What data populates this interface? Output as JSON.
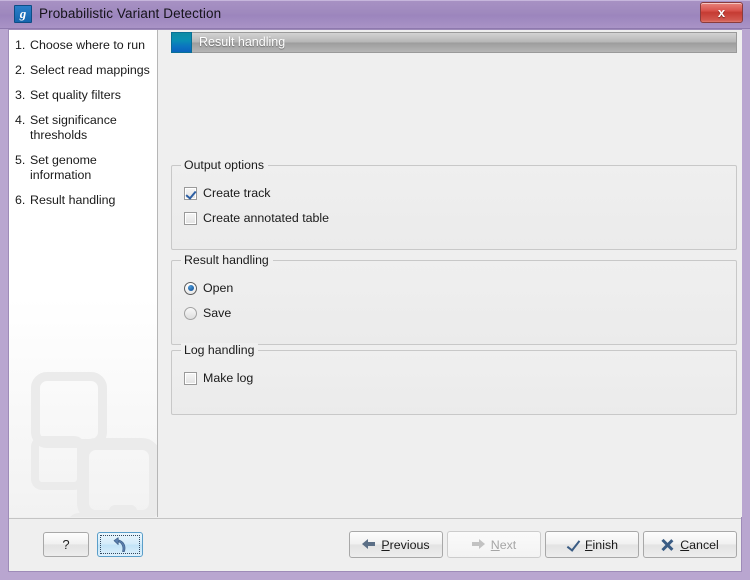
{
  "window": {
    "title": "Probabilistic Variant Detection",
    "app_icon": "clc-g-icon",
    "close_label": "x"
  },
  "sidebar": {
    "steps": [
      {
        "num": "1.",
        "label": "Choose where to run"
      },
      {
        "num": "2.",
        "label": "Select read mappings"
      },
      {
        "num": "3.",
        "label": "Set quality filters"
      },
      {
        "num": "4.",
        "label": "Set significance thresholds"
      },
      {
        "num": "5.",
        "label": "Set genome information"
      },
      {
        "num": "6.",
        "label": "Result handling"
      }
    ]
  },
  "panel": {
    "header_title": "Result handling",
    "groups": {
      "output_options": {
        "title": "Output options",
        "items": [
          {
            "label": "Create track",
            "checked": true
          },
          {
            "label": "Create annotated table",
            "checked": false
          }
        ]
      },
      "result_handling": {
        "title": "Result handling",
        "items": [
          {
            "label": "Open",
            "selected": true
          },
          {
            "label": "Save",
            "selected": false
          }
        ]
      },
      "log_handling": {
        "title": "Log handling",
        "items": [
          {
            "label": "Make log",
            "checked": false
          }
        ]
      }
    }
  },
  "buttons": {
    "help": "?",
    "reset": "",
    "previous": {
      "pre": "",
      "mnemonic": "P",
      "post": "revious"
    },
    "next": {
      "pre": "",
      "mnemonic": "N",
      "post": "ext"
    },
    "finish": {
      "pre": "",
      "mnemonic": "F",
      "post": "inish"
    },
    "cancel": {
      "pre": "",
      "mnemonic": "C",
      "post": "ancel"
    }
  },
  "colors": {
    "titlebar_purple": "#9f89be",
    "accent_teal": "#0a8fb4",
    "accent_blue": "#0a63bd",
    "close_red": "#c53b33",
    "panel_bg": "#efefef"
  }
}
